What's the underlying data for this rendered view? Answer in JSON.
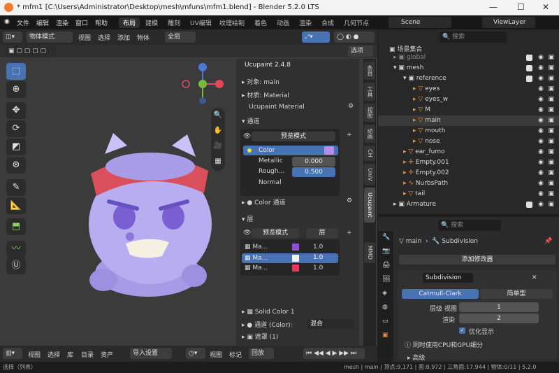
{
  "window": {
    "title": "* mfm1 [C:\\Users\\Administrator\\Desktop\\mesh\\mfuns\\mfm1.blend] - Blender 5.2.0 LTS"
  },
  "menu": [
    "文件",
    "编辑",
    "渲染",
    "窗口",
    "帮助"
  ],
  "workspaces": [
    "布局",
    "建模",
    "雕刻",
    "UV编辑",
    "纹理绘制",
    "着色",
    "动画",
    "渲染",
    "合成",
    "几何节点"
  ],
  "scene": {
    "name": "Scene",
    "view_layer": "ViewLayer"
  },
  "viewport": {
    "mode": "物体模式",
    "menus": [
      "视图",
      "选择",
      "添加",
      "物体"
    ],
    "orientation": "全局",
    "options_label": "选项"
  },
  "npanel": {
    "title": "Ucupaint 2.4.8",
    "object_label": "对象: main",
    "material_label": "材质: Material",
    "ucupaint_material": "Ucupaint Material",
    "channels_label": "通道",
    "preview_mode": "预览模式",
    "channels": [
      {
        "name": "Color",
        "value": ""
      },
      {
        "name": "Metallic",
        "value": "0.000"
      },
      {
        "name": "Rough...",
        "value": "0.500"
      },
      {
        "name": "Normal",
        "value": ""
      }
    ],
    "color_channel_label": "Color 通道",
    "layers_label": "层",
    "layer_preview_mode": "预览模式",
    "layer_dropdown": "层",
    "layers": [
      {
        "name": "Ma...",
        "value": "1.0",
        "color": "#8c4fd6"
      },
      {
        "name": "Ma...",
        "value": "1.0",
        "color": "#f2f2f2"
      },
      {
        "name": "Ma...",
        "value": "1.0",
        "color": "#e8385a"
      }
    ],
    "solid_color": "Solid Color 1",
    "channel_color_label": "通道 (Color):",
    "blend_mode": "混合",
    "mask_label": "遮罩 (1)",
    "tabs": [
      "条目",
      "工具",
      "视图",
      "动画",
      "CH",
      "UniV",
      "Ucupaint",
      "MMD"
    ]
  },
  "outliner": {
    "title": "场景集合",
    "search_placeholder": "搜索",
    "items": [
      {
        "name": "global",
        "indent": 0
      },
      {
        "name": "mesh",
        "indent": 0
      },
      {
        "name": "reference",
        "indent": 1
      },
      {
        "name": "eyes",
        "indent": 2
      },
      {
        "name": "eyes_w",
        "indent": 2
      },
      {
        "name": "M",
        "indent": 2
      },
      {
        "name": "main",
        "indent": 2
      },
      {
        "name": "mouth",
        "indent": 2
      },
      {
        "name": "nose",
        "indent": 2
      },
      {
        "name": "ear_fumo",
        "indent": 1
      },
      {
        "name": "Empty.001",
        "indent": 1
      },
      {
        "name": "Empty.002",
        "indent": 1
      },
      {
        "name": "NurbsPath",
        "indent": 1
      },
      {
        "name": "tail",
        "indent": 1
      },
      {
        "name": "Armature",
        "indent": 0
      }
    ]
  },
  "properties": {
    "search_placeholder": "搜索",
    "breadcrumb_object": "main",
    "breadcrumb_modifier": "Subdivision",
    "add_modifier": "添加修改器",
    "modifier_name": "Subdivision",
    "catmull": "Catmull-Clark",
    "simple": "简单型",
    "levels_viewport_label": "层级 视图",
    "levels_viewport": "1",
    "render_label": "渲染",
    "render_levels": "2",
    "optimal_display": "优化显示",
    "gpu_subdiv": "同时使用CPU和GPU细分",
    "advanced": "高级"
  },
  "timeline": {
    "menus": [
      "视图",
      "选择",
      "库",
      "目录",
      "资产"
    ],
    "import": "导入设置",
    "menus2": [
      "视图",
      "标记"
    ],
    "playback": "回放"
  },
  "status": {
    "left": "选择（列表）",
    "right": "mesh | main | 顶点:9,171 | 面:8,972 | 三角面:17,944 | 物体:0/11 | 5.2.0"
  }
}
